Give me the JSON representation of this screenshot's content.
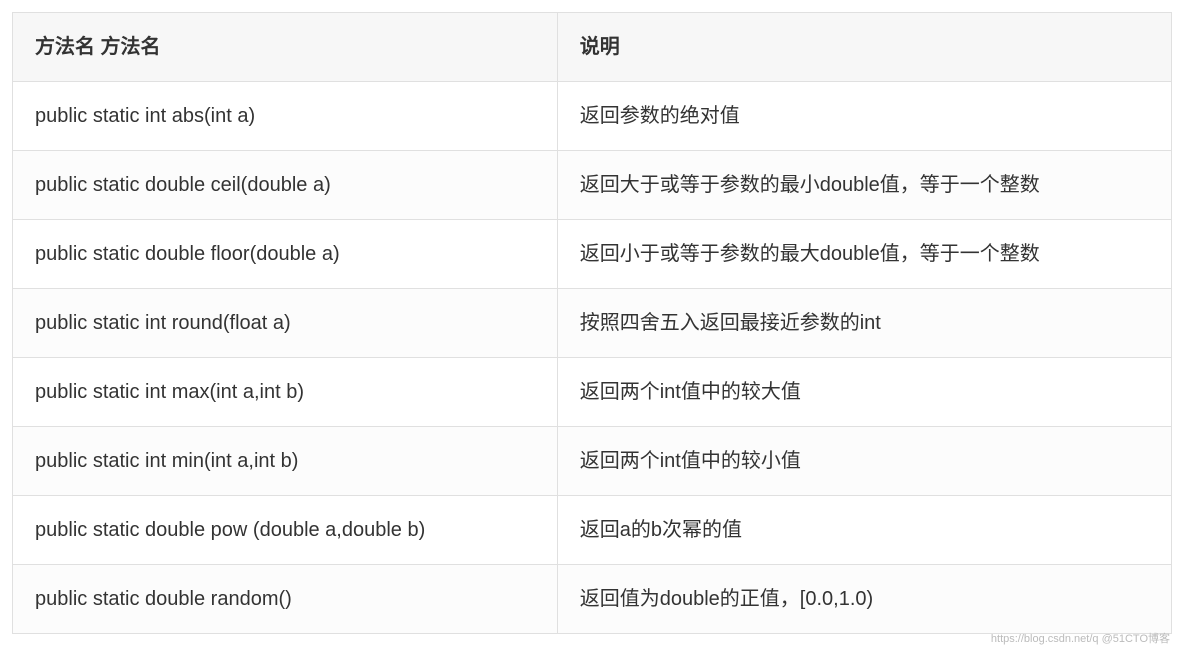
{
  "table": {
    "headers": {
      "method": "方法名    方法名",
      "description": "说明"
    },
    "rows": [
      {
        "method": "public static int   abs(int a)",
        "description": "返回参数的绝对值"
      },
      {
        "method": "public static double ceil(double a)",
        "description": "返回大于或等于参数的最小double值，等于一个整数"
      },
      {
        "method": "public static double floor(double a)",
        "description": "返回小于或等于参数的最大double值，等于一个整数"
      },
      {
        "method": "public   static int round(float a)",
        "description": "按照四舍五入返回最接近参数的int"
      },
      {
        "method": "public static int   max(int a,int b)",
        "description": "返回两个int值中的较大值"
      },
      {
        "method": "public   static int min(int a,int b)",
        "description": "返回两个int值中的较小值"
      },
      {
        "method": "public   static double pow (double a,double b)",
        "description": "返回a的b次幂的值"
      },
      {
        "method": "public   static double random()",
        "description": "返回值为double的正值，[0.0,1.0)"
      }
    ]
  },
  "watermark": "https://blog.csdn.net/q  @51CTO博客"
}
